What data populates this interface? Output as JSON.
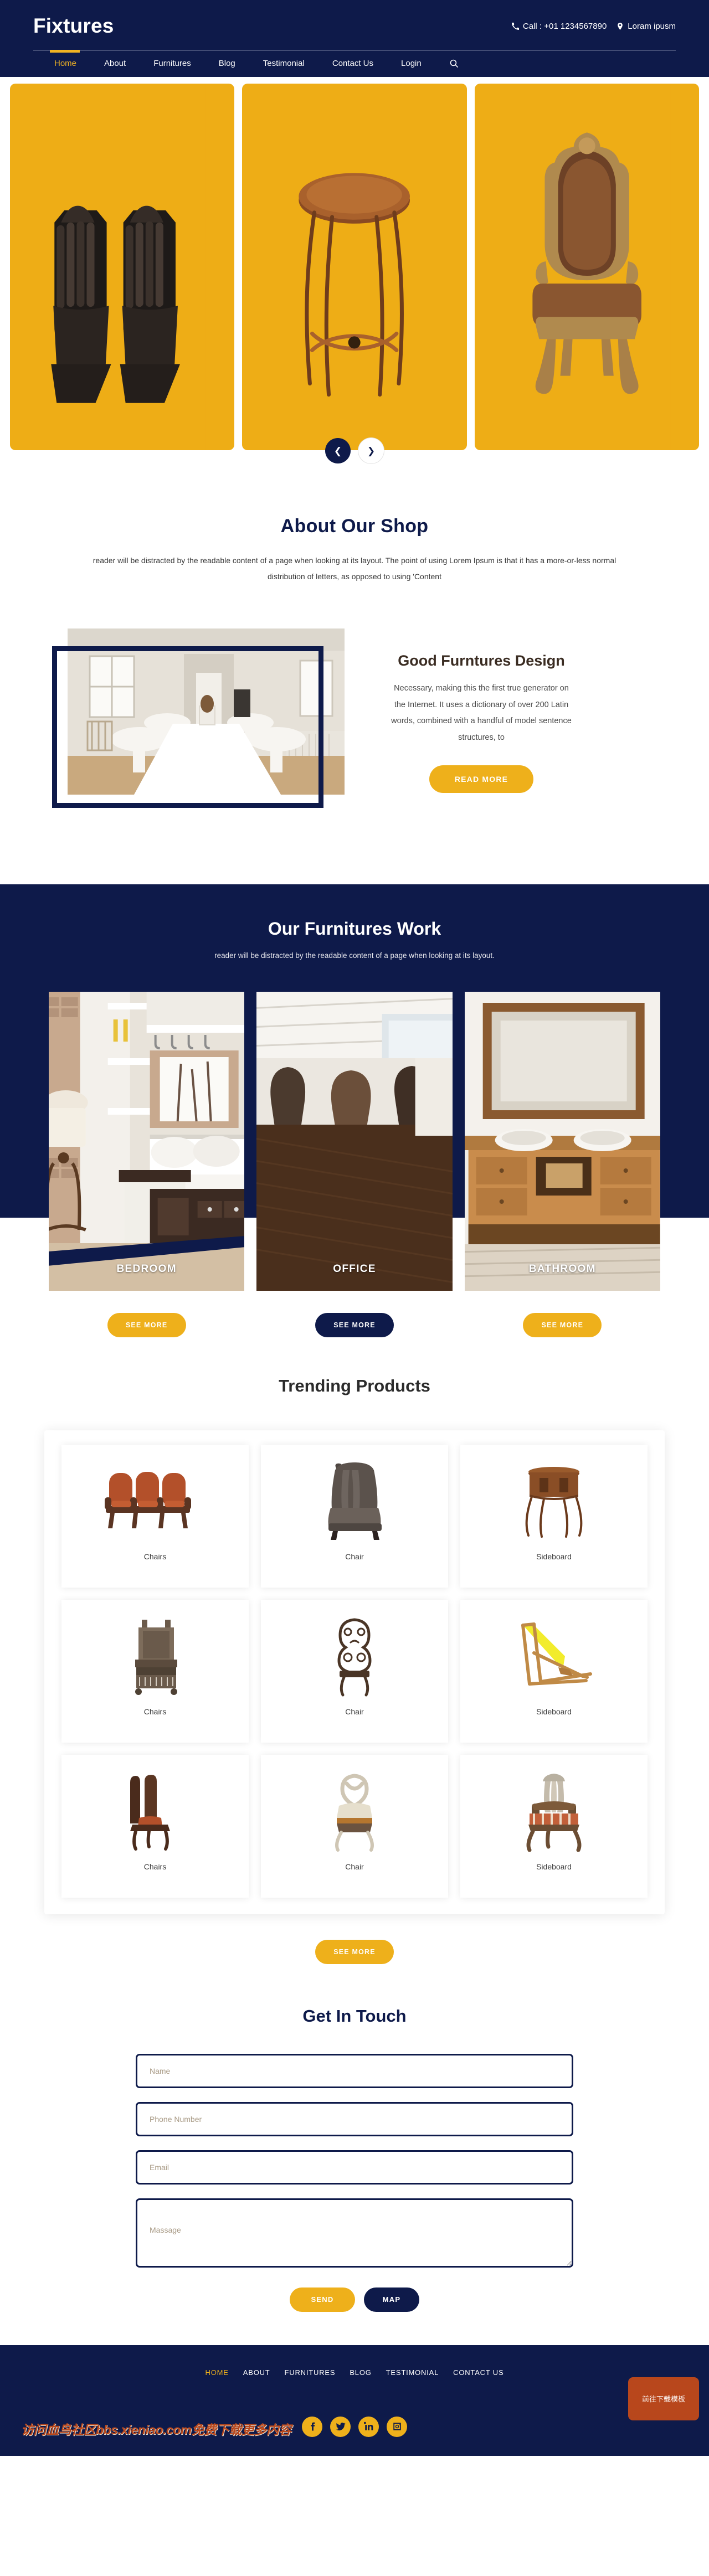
{
  "header": {
    "logo": "Fixtures",
    "call_label": "Call : +01 1234567890",
    "location_label": "Loram ipusm",
    "phone_icon": "phone-icon",
    "pin_icon": "map-pin-icon",
    "search_icon": "search-icon",
    "nav": [
      {
        "label": "Home",
        "active": true
      },
      {
        "label": "About",
        "active": false
      },
      {
        "label": "Furnitures",
        "active": false
      },
      {
        "label": "Blog",
        "active": false
      },
      {
        "label": "Testimonial",
        "active": false
      },
      {
        "label": "Contact Us",
        "active": false
      },
      {
        "label": "Login",
        "active": false
      }
    ]
  },
  "hero": {
    "background": "#eead16",
    "slides": [
      {
        "alt": "black-leather-recliner-chairs"
      },
      {
        "alt": "round-wooden-pedestal-table"
      },
      {
        "alt": "ornate-gilded-throne-armchair"
      }
    ],
    "prev_icon": "arrow-left-icon",
    "next_icon": "arrow-right-icon"
  },
  "about": {
    "title": "About Our Shop",
    "subtitle": "reader will be distracted by the readable content of a page when looking at its layout. The point of using Lorem Ipsum is that it has a more-or-less normal distribution of letters, as opposed to using 'Content",
    "image_alt": "white-dining-table-interior",
    "heading": "Good Furntures Design",
    "paragraph": "Necessary, making this the first true generator on the Internet. It uses a dictionary of over 200 Latin words, combined with a handful of model sentence structures, to",
    "button": "READ MORE"
  },
  "work": {
    "title": "Our Furnitures Work",
    "subtitle": "reader will be distracted by the readable content of a page when looking at its layout.",
    "cards": [
      {
        "label": "BEDROOM",
        "button": "SEE MORE",
        "button_style": "yellow",
        "image_alt": "bedroom-entry-bench-shelving"
      },
      {
        "label": "OFFICE",
        "button": "SEE MORE",
        "button_style": "navy",
        "image_alt": "office-desks-chairs"
      },
      {
        "label": "BATHROOM",
        "button": "SEE MORE",
        "button_style": "yellow",
        "image_alt": "bathroom-double-vanity-mirror"
      }
    ]
  },
  "trending": {
    "title": "Trending Products",
    "products": [
      {
        "label": "Chairs",
        "image_alt": "row-of-three-orange-armchairs"
      },
      {
        "label": "Chair",
        "image_alt": "tall-tufted-grey-wingback-chair"
      },
      {
        "label": "Sideboard",
        "image_alt": "small-round-side-table"
      },
      {
        "label": "Chairs",
        "image_alt": "antique-wooden-commode-chair"
      },
      {
        "label": "Chair",
        "image_alt": "iron-scrollwork-chair"
      },
      {
        "label": "Sideboard",
        "image_alt": "yellow-folding-deck-chair"
      },
      {
        "label": "Chairs",
        "image_alt": "pair-of-dark-wood-chairs"
      },
      {
        "label": "Chair",
        "image_alt": "cream-upholstered-loop-back-chair"
      },
      {
        "label": "Sideboard",
        "image_alt": "carved-striped-seat-armchair"
      }
    ],
    "button": "SEE MORE"
  },
  "contact": {
    "title": "Get In Touch",
    "fields": [
      {
        "name": "name",
        "placeholder": "Name",
        "value": "",
        "type": "input"
      },
      {
        "name": "phone",
        "placeholder": "Phone Number",
        "value": "",
        "type": "input"
      },
      {
        "name": "email",
        "placeholder": "Email",
        "value": "",
        "type": "input"
      },
      {
        "name": "message",
        "placeholder": "Massage",
        "value": "",
        "type": "textarea"
      }
    ],
    "send_button": "SEND",
    "map_button": "MAP"
  },
  "footer": {
    "nav": [
      {
        "label": "HOME",
        "active": true
      },
      {
        "label": "ABOUT",
        "active": false
      },
      {
        "label": "FURNITURES",
        "active": false
      },
      {
        "label": "BLOG",
        "active": false
      },
      {
        "label": "TESTIMONIAL",
        "active": false
      },
      {
        "label": "CONTACT US",
        "active": false
      }
    ],
    "socials": [
      {
        "name": "facebook-icon"
      },
      {
        "name": "twitter-icon"
      },
      {
        "name": "linkedin-icon"
      },
      {
        "name": "instagram-icon"
      }
    ],
    "watermark": "访问血鸟社区bbs.xieniao.com免费下载更多内容",
    "download_badge": "前往下载模板"
  },
  "colors": {
    "navy": "#0e1a4a",
    "yellow": "#eeb01b",
    "hero_yellow": "#eead16",
    "watermark_red": "#b8471c"
  }
}
